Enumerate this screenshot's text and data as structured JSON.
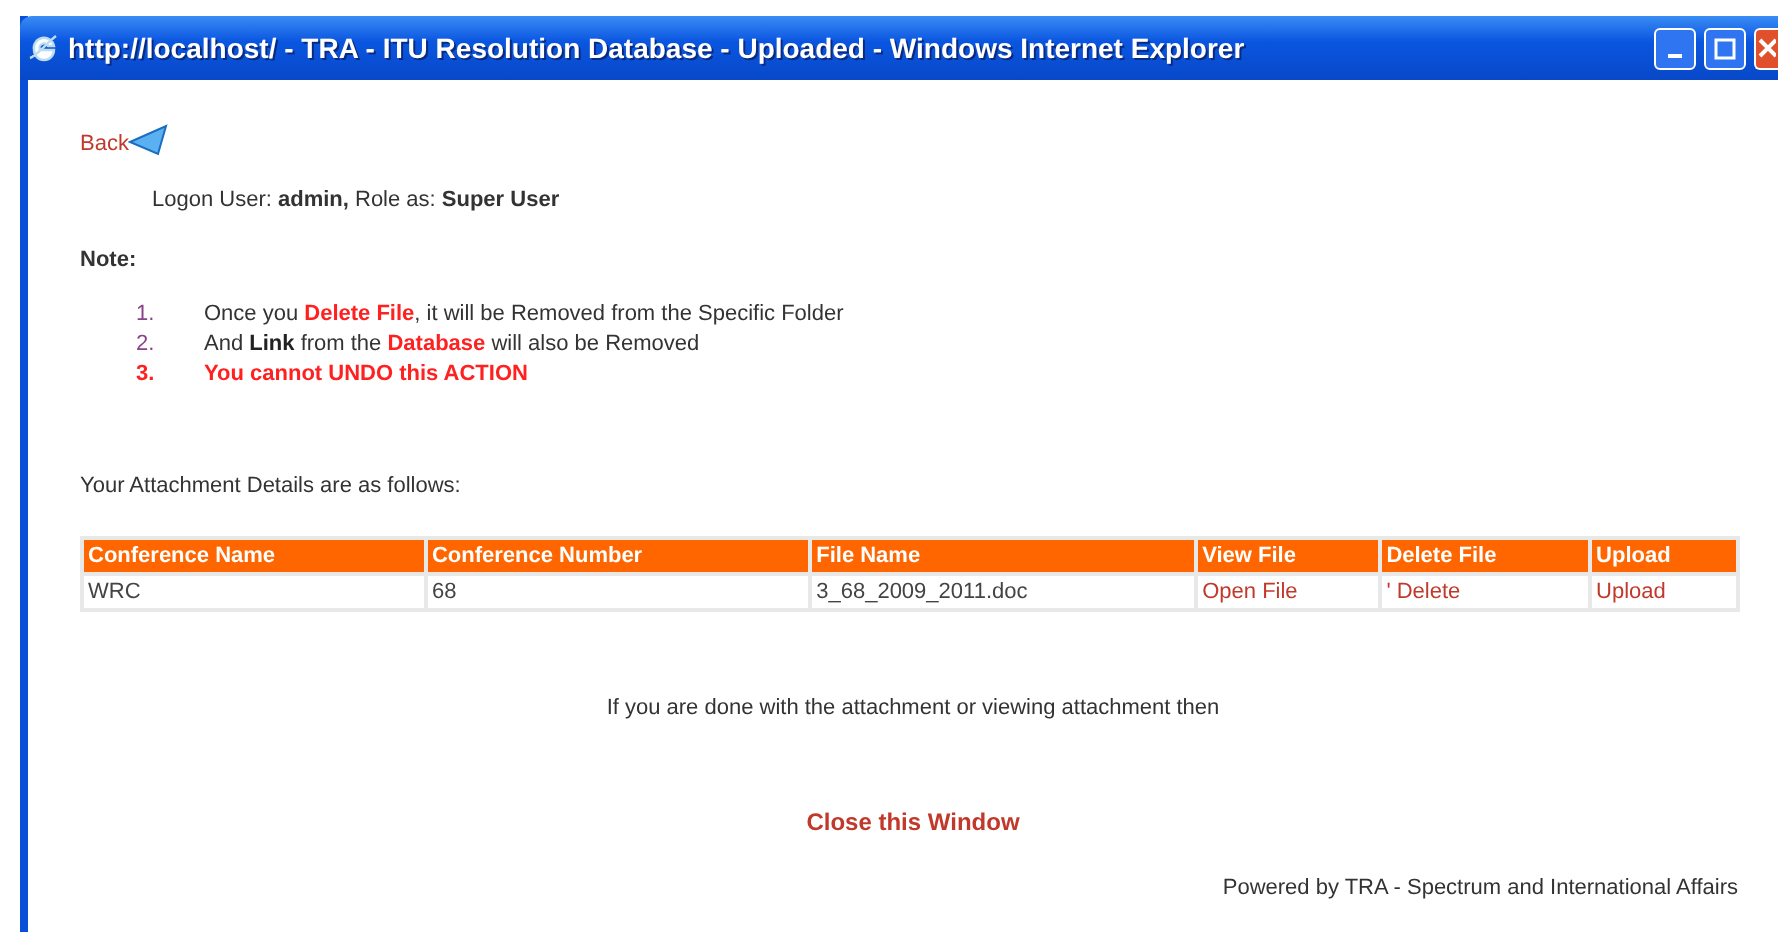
{
  "window": {
    "title": "http://localhost/ - TRA - ITU Resolution Database - Uploaded - Windows Internet Explorer"
  },
  "back_link": "Back",
  "logon": {
    "label": "Logon User: **admin,** Role as: **Super User**"
  },
  "note": {
    "heading": "Note:",
    "items": [
      {
        "number": "1.",
        "warning": false,
        "parts": [
          {
            "kind": "plain",
            "text": "Once you "
          },
          {
            "kind": "highlight",
            "text": "Delete File"
          },
          {
            "kind": "plain",
            "text": ", it will be Removed from the Specific Folder"
          }
        ]
      },
      {
        "number": "2.",
        "warning": false,
        "parts": [
          {
            "kind": "plain",
            "text": "And "
          },
          {
            "kind": "bold",
            "text": "Link"
          },
          {
            "kind": "plain",
            "text": " from the "
          },
          {
            "kind": "highlight",
            "text": "Database"
          },
          {
            "kind": "plain",
            "text": " will also be Removed"
          }
        ]
      },
      {
        "number": "3.",
        "warning": true,
        "parts": [
          {
            "kind": "plain",
            "text": "You cannot UNDO this ACTION"
          }
        ]
      }
    ]
  },
  "intro": "Your Attachment Details are as follows:",
  "table": {
    "columns": [
      "Conference Name",
      "Conference Number",
      "File Name",
      "View File",
      "Delete File",
      "Upload"
    ],
    "rows": [
      [
        {
          "kind": "text",
          "text": "WRC"
        },
        {
          "kind": "text",
          "text": "68"
        },
        {
          "kind": "text",
          "text": "3_68_2009_2011.doc"
        },
        {
          "kind": "link",
          "text": "Open File"
        },
        {
          "kind": "link",
          "text": "' Delete"
        },
        {
          "kind": "link",
          "text": "Upload"
        }
      ]
    ]
  },
  "done_text": "If you are done with the attachment or viewing attachment then",
  "close_link": "Close this Window",
  "footer": "Powered by TRA - Spectrum and International Affairs"
}
